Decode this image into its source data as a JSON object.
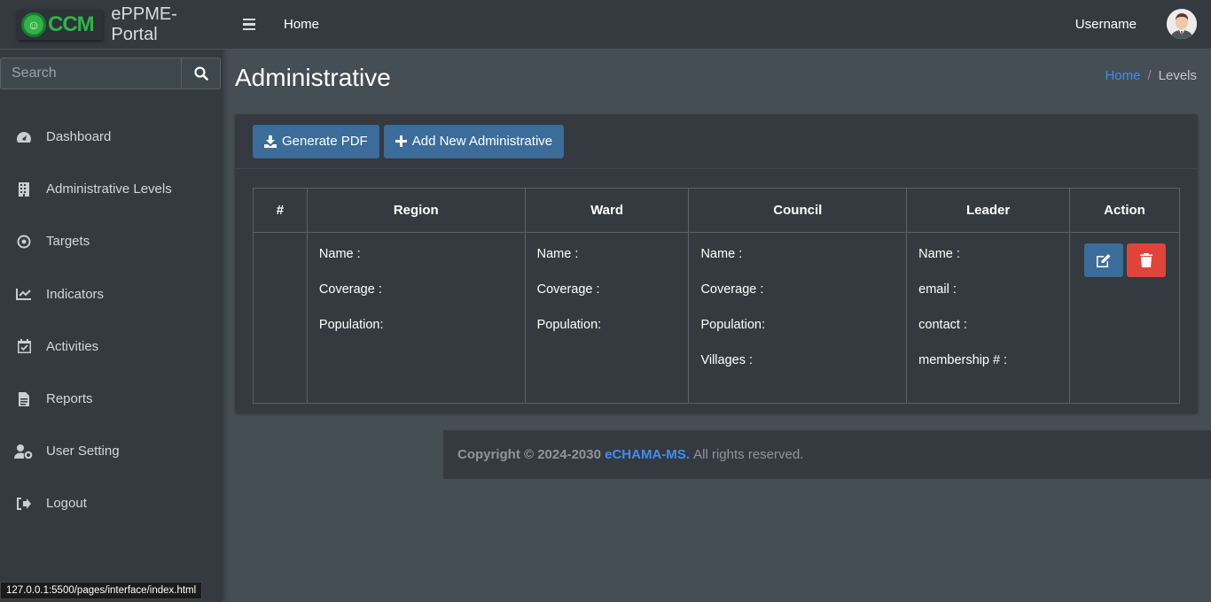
{
  "brand": {
    "logo_text": "CCM",
    "name": "ePPME-Portal"
  },
  "search": {
    "placeholder": "Search"
  },
  "sidebar": {
    "items": [
      {
        "label": "Dashboard",
        "icon": "dashboard-icon"
      },
      {
        "label": "Administrative Levels",
        "icon": "building-icon"
      },
      {
        "label": "Targets",
        "icon": "target-icon"
      },
      {
        "label": "Indicators",
        "icon": "chart-line-icon"
      },
      {
        "label": "Activities",
        "icon": "calendar-check-icon"
      },
      {
        "label": "Reports",
        "icon": "file-icon"
      },
      {
        "label": "User Setting",
        "icon": "user-cog-icon"
      },
      {
        "label": "Logout",
        "icon": "sign-out-icon"
      }
    ]
  },
  "topbar": {
    "home": "Home",
    "username": "Username"
  },
  "page": {
    "title": "Administrative",
    "breadcrumb": {
      "home": "Home",
      "sep": "/",
      "current": "Levels"
    }
  },
  "toolbar": {
    "generate_pdf": "Generate PDF",
    "add_new": "Add New Administrative"
  },
  "table": {
    "headers": [
      "#",
      "Region",
      "Ward",
      "Council",
      "Leader",
      "Action"
    ],
    "row": {
      "number": "",
      "region": [
        "Name :",
        "Coverage :",
        "Population:"
      ],
      "ward": [
        "Name :",
        "Coverage :",
        "Population:"
      ],
      "council": [
        "Name :",
        "Coverage :",
        "Population:",
        "Villages :"
      ],
      "leader": [
        "Name :",
        "email :",
        "contact :",
        "membership # :"
      ]
    }
  },
  "footer": {
    "copyright": "Copyright © 2024-2030",
    "brand": "eCHAMA-MS.",
    "rights": "All rights reserved."
  },
  "statusbar": {
    "url": "127.0.0.1:5500/pages/interface/index.html"
  },
  "colors": {
    "accent_blue": "#3c6d9a",
    "danger": "#e0433a",
    "link": "#3f8ef0",
    "sidebar_bg": "#343a40",
    "content_bg": "#454d55"
  }
}
